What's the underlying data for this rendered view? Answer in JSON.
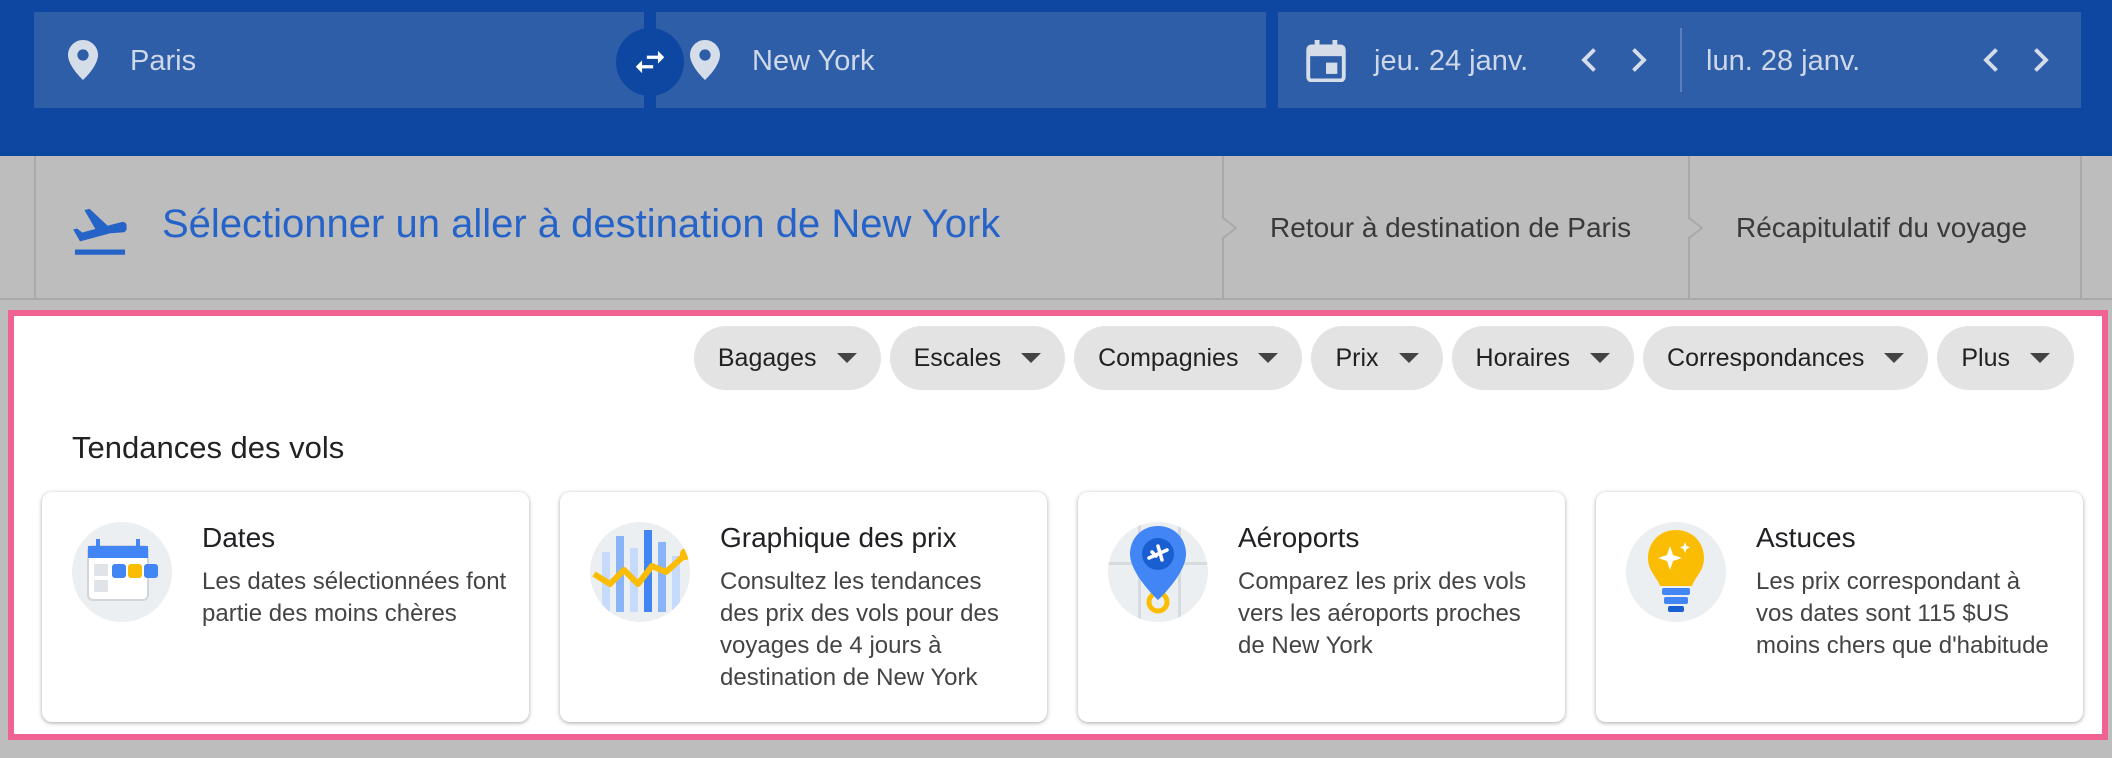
{
  "search": {
    "origin": "Paris",
    "destination": "New York",
    "depart_date": "jeu. 24 janv.",
    "return_date": "lun. 28 janv."
  },
  "stepper": {
    "current": "Sélectionner un aller à destination de New York",
    "step2": "Retour à destination de Paris",
    "step3": "Récapitulatif du voyage"
  },
  "filters": [
    "Bagages",
    "Escales",
    "Compagnies",
    "Prix",
    "Horaires",
    "Correspondances",
    "Plus"
  ],
  "trends": {
    "title": "Tendances des vols",
    "cards": [
      {
        "title": "Dates",
        "description": "Les dates sélectionnées font partie des moins chères",
        "icon": "calendar-dates-icon"
      },
      {
        "title": "Graphique des prix",
        "description": "Consultez les tendances des prix des vols pour des voyages de 4 jours à destination de New York",
        "icon": "price-graph-icon"
      },
      {
        "title": "Aéroports",
        "description": "Comparez les prix des vols vers les aéroports proches de New York",
        "icon": "airport-pin-icon"
      },
      {
        "title": "Astuces",
        "description": "Les prix correspondant à vos dates sont 115 $US moins chers que d'habitude",
        "icon": "lightbulb-icon"
      }
    ]
  },
  "colors": {
    "topbar": "#0d47a1",
    "field": "#2e5ea7",
    "accent": "#2563c9",
    "highlight_border": "#f06292"
  }
}
